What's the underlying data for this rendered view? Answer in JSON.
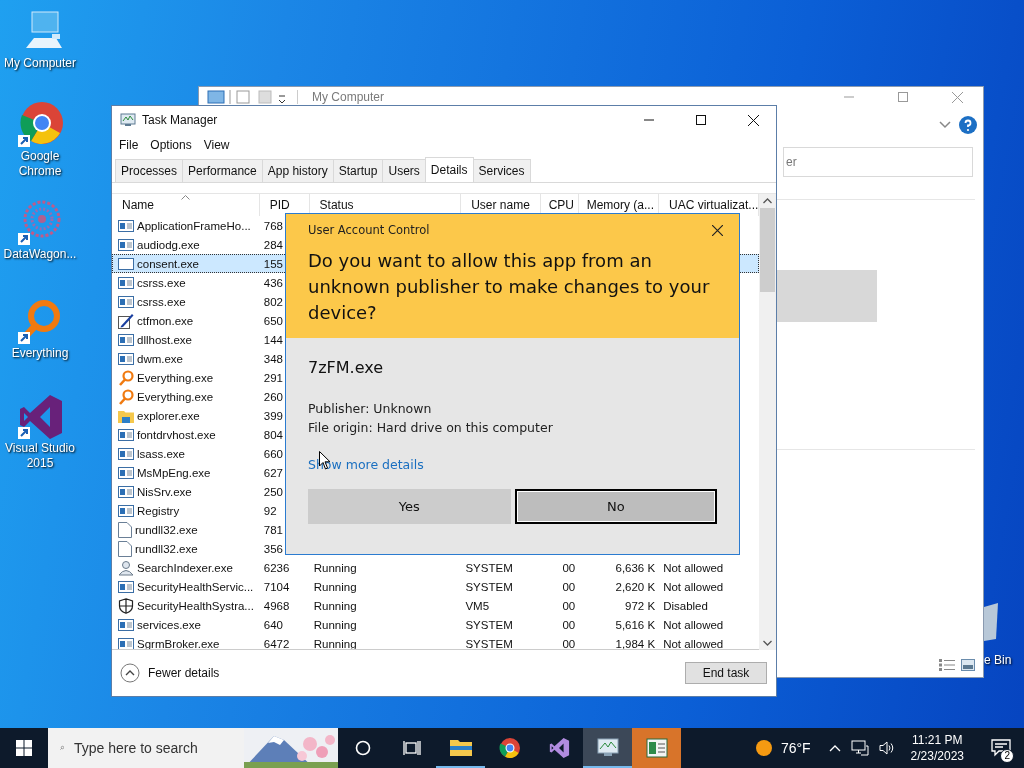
{
  "desktop_icons": [
    {
      "label": "My Computer",
      "kind": "computer"
    },
    {
      "label": "Google Chrome",
      "kind": "chrome"
    },
    {
      "label": "DataWagon...",
      "kind": "datawagon"
    },
    {
      "label": "Everything",
      "kind": "everything"
    },
    {
      "label": "Visual Studio 2015",
      "kind": "vs"
    }
  ],
  "recycle_bin": {
    "label": "e Bin"
  },
  "explorer": {
    "title": "My Computer",
    "search": {
      "placeholder": "er"
    }
  },
  "task_manager": {
    "title": "Task Manager",
    "menu": [
      "File",
      "Options",
      "View"
    ],
    "tabs": [
      {
        "label": "Processes",
        "selected": false
      },
      {
        "label": "Performance",
        "selected": false
      },
      {
        "label": "App history",
        "selected": false
      },
      {
        "label": "Startup",
        "selected": false
      },
      {
        "label": "Users",
        "selected": false
      },
      {
        "label": "Details",
        "selected": true
      },
      {
        "label": "Services",
        "selected": false
      }
    ],
    "columns": [
      {
        "label": "Name",
        "sorted": true
      },
      {
        "label": "PID",
        "sorted": false
      },
      {
        "label": "Status",
        "sorted": false
      },
      {
        "label": "User name",
        "sorted": false
      },
      {
        "label": "CPU",
        "sorted": false
      },
      {
        "label": "Memory (a...",
        "sorted": false
      },
      {
        "label": "UAC virtualizat...",
        "sorted": false
      }
    ],
    "rows": [
      {
        "kind": "app",
        "cells": [
          "ApplicationFrameHo...",
          "768"
        ],
        "selected": false
      },
      {
        "kind": "app",
        "cells": [
          "audiodg.exe",
          "284"
        ],
        "selected": false
      },
      {
        "kind": "blank",
        "cells": [
          "consent.exe",
          "155"
        ],
        "selected": true
      },
      {
        "kind": "app",
        "cells": [
          "csrss.exe",
          "436"
        ],
        "selected": false
      },
      {
        "kind": "app",
        "cells": [
          "csrss.exe",
          "802"
        ],
        "selected": false
      },
      {
        "kind": "pen",
        "cells": [
          "ctfmon.exe",
          "650"
        ],
        "selected": false
      },
      {
        "kind": "app",
        "cells": [
          "dllhost.exe",
          "144"
        ],
        "selected": false
      },
      {
        "kind": "app",
        "cells": [
          "dwm.exe",
          "348"
        ],
        "selected": false
      },
      {
        "kind": "magnifier",
        "cells": [
          "Everything.exe",
          "291"
        ],
        "selected": false
      },
      {
        "kind": "magnifier",
        "cells": [
          "Everything.exe",
          "260"
        ],
        "selected": false
      },
      {
        "kind": "folder",
        "cells": [
          "explorer.exe",
          "399"
        ],
        "selected": false
      },
      {
        "kind": "app",
        "cells": [
          "fontdrvhost.exe",
          "804"
        ],
        "selected": false
      },
      {
        "kind": "app",
        "cells": [
          "lsass.exe",
          "660"
        ],
        "selected": false
      },
      {
        "kind": "app",
        "cells": [
          "MsMpEng.exe",
          "627"
        ],
        "selected": false
      },
      {
        "kind": "app",
        "cells": [
          "NisSrv.exe",
          "250"
        ],
        "selected": false
      },
      {
        "kind": "app",
        "cells": [
          "Registry",
          "92"
        ],
        "selected": false
      },
      {
        "kind": "document",
        "cells": [
          "rundll32.exe",
          "781"
        ],
        "selected": false
      },
      {
        "kind": "document",
        "cells": [
          "rundll32.exe",
          "356"
        ],
        "selected": false
      },
      {
        "kind": "person",
        "cells": [
          "SearchIndexer.exe",
          "6236",
          "Running",
          "SYSTEM",
          "00",
          "6,636 K",
          "Not allowed"
        ],
        "selected": false
      },
      {
        "kind": "app",
        "cells": [
          "SecurityHealthServic...",
          "7104",
          "Running",
          "SYSTEM",
          "00",
          "2,620 K",
          "Not allowed"
        ],
        "selected": false
      },
      {
        "kind": "shield",
        "cells": [
          "SecurityHealthSystra...",
          "4968",
          "Running",
          "VM5",
          "00",
          "972 K",
          "Disabled"
        ],
        "selected": false
      },
      {
        "kind": "app",
        "cells": [
          "services.exe",
          "640",
          "Running",
          "SYSTEM",
          "00",
          "5,616 K",
          "Not allowed"
        ],
        "selected": false
      },
      {
        "kind": "app",
        "cells": [
          "SgrmBroker.exe",
          "6472",
          "Running",
          "SYSTEM",
          "00",
          "1,984 K",
          "Not allowed"
        ],
        "selected": false
      }
    ],
    "footer": {
      "toggle": "Fewer details",
      "button": "End task"
    }
  },
  "uac": {
    "title": "User Account Control",
    "question": "Do you want to allow this app from an unknown publisher to make changes to your device?",
    "app_name": "7zFM.exe",
    "publisher": "Publisher: Unknown",
    "origin": "File origin: Hard drive on this computer",
    "link": "Show more details",
    "buttons": [
      {
        "label": "Yes",
        "focused": false
      },
      {
        "label": "No",
        "focused": true
      }
    ]
  },
  "taskbar": {
    "search_placeholder": "Type here to search",
    "apps": [
      {
        "kind": "cortana",
        "running": false,
        "active": false,
        "flashing": false
      },
      {
        "kind": "taskview",
        "running": false,
        "active": false,
        "flashing": false
      },
      {
        "kind": "folder",
        "running": true,
        "active": false,
        "flashing": false
      },
      {
        "kind": "chrome",
        "running": false,
        "active": false,
        "flashing": false
      },
      {
        "kind": "vs",
        "running": false,
        "active": false,
        "flashing": false
      },
      {
        "kind": "taskmgr",
        "running": true,
        "active": true,
        "flashing": false
      },
      {
        "kind": "sheet",
        "running": false,
        "active": false,
        "flashing": true
      }
    ],
    "weather": "76°F",
    "time": "11:21 PM",
    "date": "2/23/2023",
    "notifications": "2"
  }
}
